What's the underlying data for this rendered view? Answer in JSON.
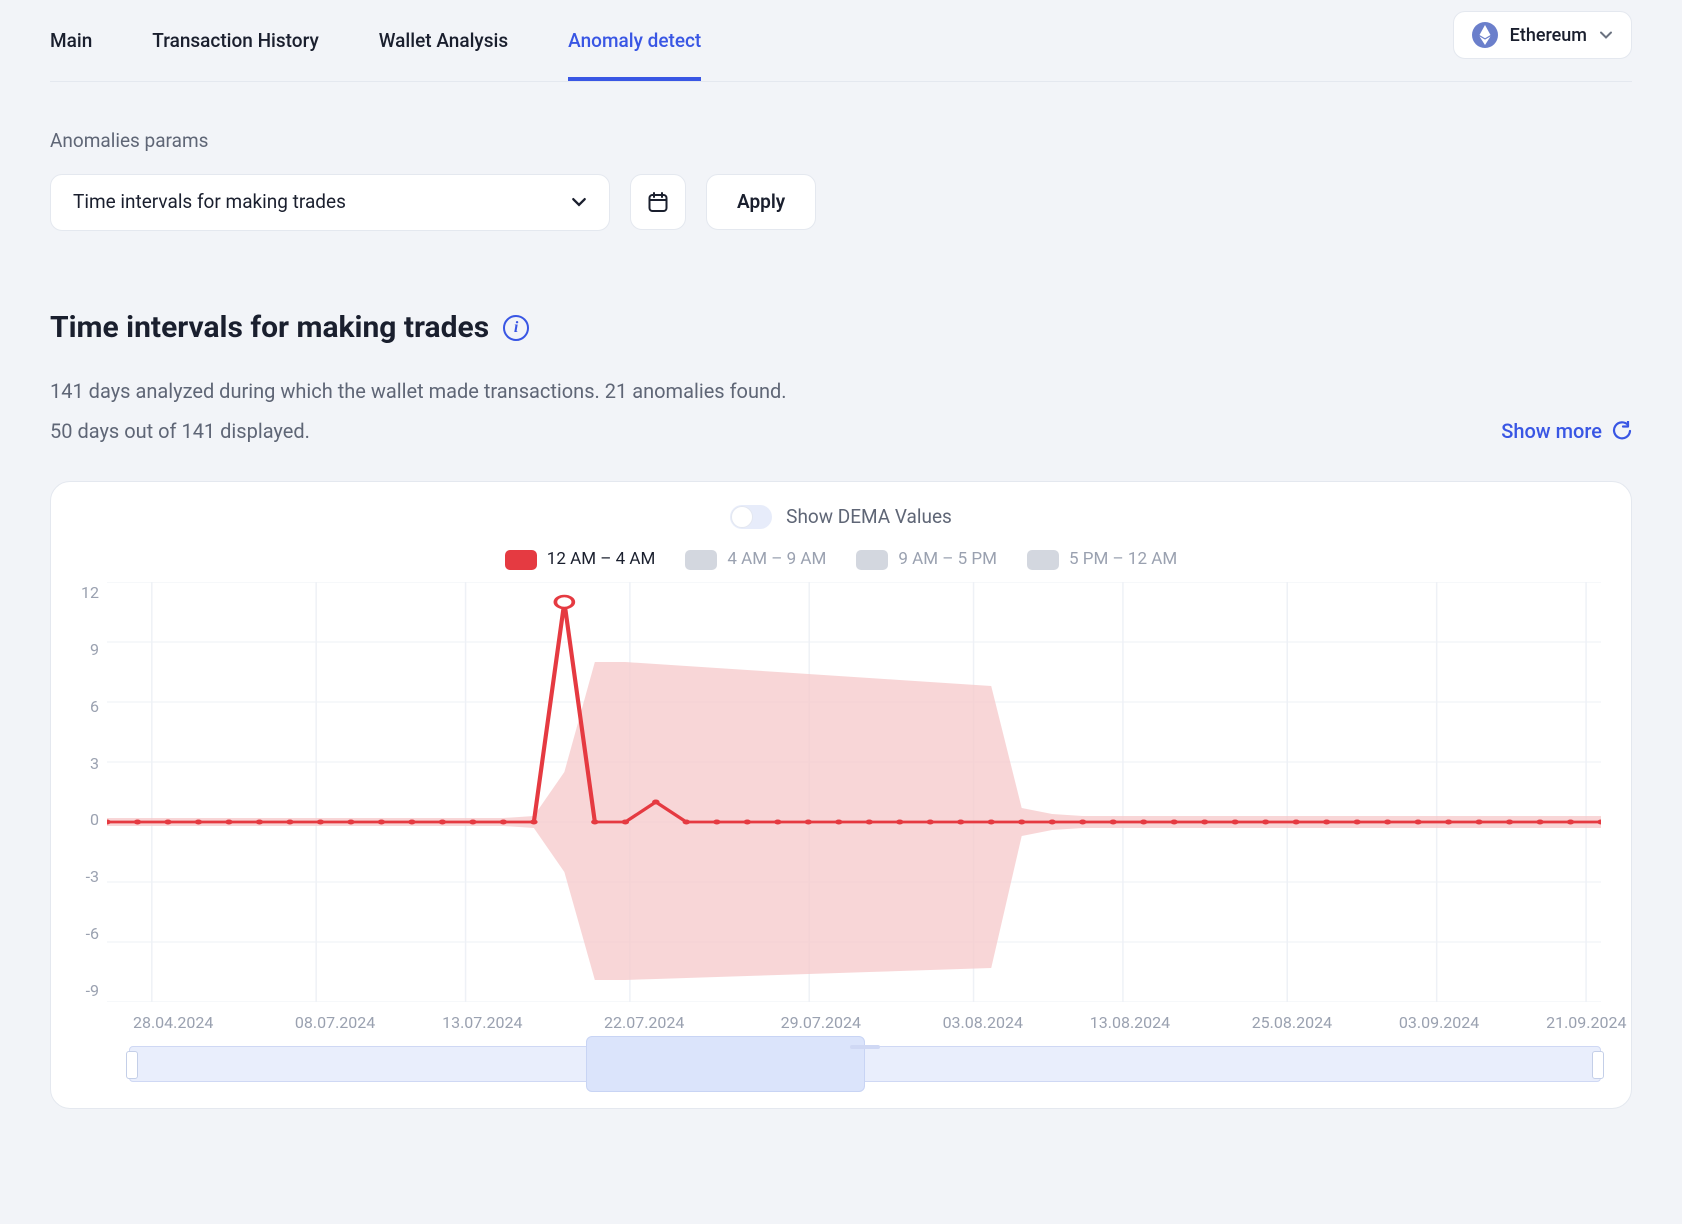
{
  "tabs": {
    "items": [
      "Main",
      "Transaction History",
      "Wallet Analysis",
      "Anomaly detect"
    ],
    "active_index": 3
  },
  "chain_select": {
    "label": "Ethereum"
  },
  "params": {
    "label": "Anomalies params",
    "dropdown_value": "Time intervals for making trades",
    "apply_label": "Apply"
  },
  "section": {
    "title": "Time intervals for making trades",
    "summary": "141 days analyzed during which the wallet made transactions. 21 anomalies found.",
    "displayed": "50 days out of 141 displayed.",
    "show_more": "Show more"
  },
  "toggle": {
    "label": "Show DEMA Values",
    "on": false
  },
  "legend": {
    "items": [
      {
        "label": "12 AM – 4 AM",
        "color": "#e53a41",
        "muted": false
      },
      {
        "label": "4 AM – 9 AM",
        "color": "#d3d7df",
        "muted": true
      },
      {
        "label": "9 AM – 5 PM",
        "color": "#d3d7df",
        "muted": true
      },
      {
        "label": "5 PM – 12 AM",
        "color": "#d3d7df",
        "muted": true
      }
    ]
  },
  "chart_data": {
    "type": "line",
    "title": "Time intervals for making trades",
    "xlabel": "",
    "ylabel": "",
    "ylim": [
      -9,
      12
    ],
    "y_ticks": [
      12,
      9,
      6,
      3,
      0,
      -3,
      -6,
      -9
    ],
    "x_tick_labels": [
      "28.04.2024",
      "08.07.2024",
      "13.07.2024",
      "22.07.2024",
      "29.07.2024",
      "03.08.2024",
      "13.08.2024",
      "25.08.2024",
      "03.09.2024",
      "21.09.2024"
    ],
    "x_tick_positions_pct": [
      3,
      14,
      24,
      35,
      47,
      58,
      68,
      79,
      89,
      99
    ],
    "x": [
      0,
      1,
      2,
      3,
      4,
      5,
      6,
      7,
      8,
      9,
      10,
      11,
      12,
      13,
      14,
      15,
      16,
      17,
      18,
      19,
      20,
      21,
      22,
      23,
      24,
      25,
      26,
      27,
      28,
      29,
      30,
      31,
      32,
      33,
      34,
      35,
      36,
      37,
      38,
      39,
      40,
      41,
      42,
      43,
      44,
      45,
      46,
      47,
      48,
      49
    ],
    "series": [
      {
        "name": "12 AM – 4 AM",
        "color": "#e53a41",
        "values": [
          0,
          0,
          0,
          0,
          0,
          0,
          0,
          0,
          0,
          0,
          0,
          0,
          0,
          0,
          0,
          11,
          0,
          0,
          1,
          0,
          0,
          0,
          0,
          0,
          0,
          0,
          0,
          0,
          0,
          0,
          0,
          0,
          0,
          0,
          0,
          0,
          0,
          0,
          0,
          0,
          0,
          0,
          0,
          0,
          0,
          0,
          0,
          0,
          0,
          0
        ]
      }
    ],
    "anomaly_points": [
      {
        "index": 15,
        "value": 11
      }
    ],
    "band": {
      "upper": [
        0.2,
        0.2,
        0.2,
        0.2,
        0.2,
        0.2,
        0.2,
        0.2,
        0.2,
        0.2,
        0.2,
        0.2,
        0.2,
        0.2,
        0.3,
        2.5,
        8,
        8,
        7.9,
        7.8,
        7.7,
        7.6,
        7.5,
        7.4,
        7.3,
        7.2,
        7.1,
        7,
        6.9,
        6.8,
        0.7,
        0.4,
        0.3,
        0.3,
        0.3,
        0.3,
        0.3,
        0.3,
        0.3,
        0.3,
        0.3,
        0.3,
        0.3,
        0.3,
        0.3,
        0.3,
        0.3,
        0.3,
        0.3,
        0.3
      ],
      "lower": [
        -0.2,
        -0.2,
        -0.2,
        -0.2,
        -0.2,
        -0.2,
        -0.2,
        -0.2,
        -0.2,
        -0.2,
        -0.2,
        -0.2,
        -0.2,
        -0.2,
        -0.3,
        -2.5,
        -7.9,
        -7.9,
        -7.85,
        -7.8,
        -7.75,
        -7.7,
        -7.65,
        -7.6,
        -7.55,
        -7.5,
        -7.45,
        -7.4,
        -7.35,
        -7.3,
        -0.7,
        -0.4,
        -0.3,
        -0.3,
        -0.3,
        -0.3,
        -0.3,
        -0.3,
        -0.3,
        -0.3,
        -0.3,
        -0.3,
        -0.3,
        -0.3,
        -0.3,
        -0.3,
        -0.3,
        -0.3,
        -0.3,
        -0.3
      ]
    }
  }
}
